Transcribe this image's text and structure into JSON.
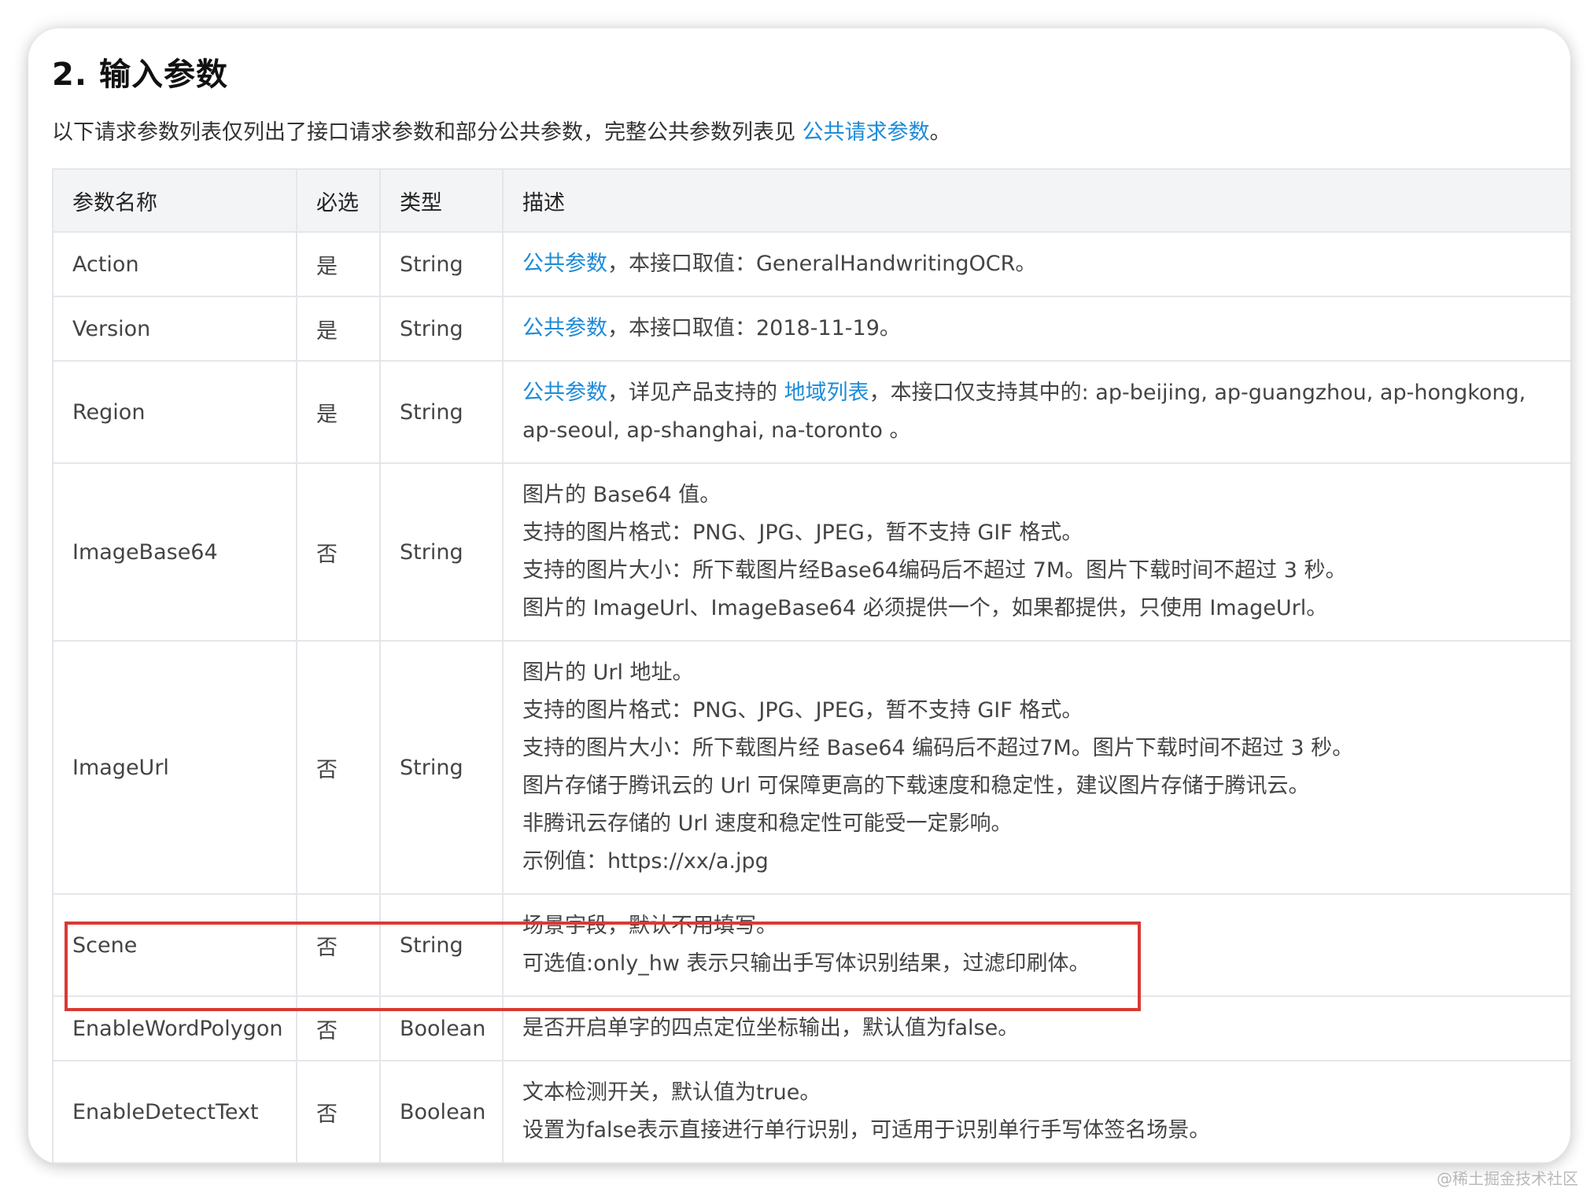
{
  "section": {
    "heading": "2. 输入参数",
    "intro_text": "以下请求参数列表仅列出了接口请求参数和部分公共参数，完整公共参数列表见 ",
    "intro_link": "公共请求参数",
    "intro_end": "。"
  },
  "table": {
    "headers": [
      "参数名称",
      "必选",
      "类型",
      "描述"
    ],
    "rows": [
      {
        "name": "Action",
        "required": "是",
        "type": "String",
        "desc": {
          "link": "公共参数",
          "text": "，本接口取值：GeneralHandwritingOCR。"
        }
      },
      {
        "name": "Version",
        "required": "是",
        "type": "String",
        "desc": {
          "link": "公共参数",
          "text": "，本接口取值：2018-11-19。"
        }
      },
      {
        "name": "Region",
        "required": "是",
        "type": "String",
        "desc": {
          "link": "公共参数",
          "text_a": "，详见产品支持的 ",
          "link2": "地域列表",
          "text_b": "，本接口仅支持其中的: ap-beijing, ap-guangzhou, ap-hongkong,",
          "line2": "ap-seoul, ap-shanghai, na-toronto 。"
        }
      },
      {
        "name": "ImageBase64",
        "required": "否",
        "type": "String",
        "lines": [
          "图片的 Base64 值。",
          "支持的图片格式：PNG、JPG、JPEG，暂不支持 GIF 格式。",
          "支持的图片大小：所下载图片经Base64编码后不超过 7M。图片下载时间不超过 3 秒。",
          "图片的 ImageUrl、ImageBase64 必须提供一个，如果都提供，只使用 ImageUrl。"
        ]
      },
      {
        "name": "ImageUrl",
        "required": "否",
        "type": "String",
        "lines": [
          "图片的 Url 地址。",
          "支持的图片格式：PNG、JPG、JPEG，暂不支持 GIF 格式。",
          "支持的图片大小：所下载图片经 Base64 编码后不超过7M。图片下载时间不超过 3 秒。",
          "图片存储于腾讯云的 Url 可保障更高的下载速度和稳定性，建议图片存储于腾讯云。",
          "非腾讯云存储的 Url 速度和稳定性可能受一定影响。",
          "示例值：https://xx/a.jpg"
        ]
      },
      {
        "name": "Scene",
        "required": "否",
        "type": "String",
        "lines": [
          "场景字段，默认不用填写。",
          "可选值:only_hw 表示只输出手写体识别结果，过滤印刷体。"
        ]
      },
      {
        "name": "EnableWordPolygon",
        "required": "否",
        "type": "Boolean",
        "lines": [
          "是否开启单字的四点定位坐标输出，默认值为false。"
        ]
      },
      {
        "name": "EnableDetectText",
        "required": "否",
        "type": "Boolean",
        "lines": [
          "文本检测开关，默认值为true。",
          "设置为false表示直接进行单行识别，可适用于识别单行手写体签名场景。"
        ]
      }
    ]
  },
  "watermark": "@稀土掘金技术社区",
  "colors": {
    "link": "#1d8bd8",
    "highlight": "#d93a34",
    "header_bg": "#f3f4f6"
  }
}
